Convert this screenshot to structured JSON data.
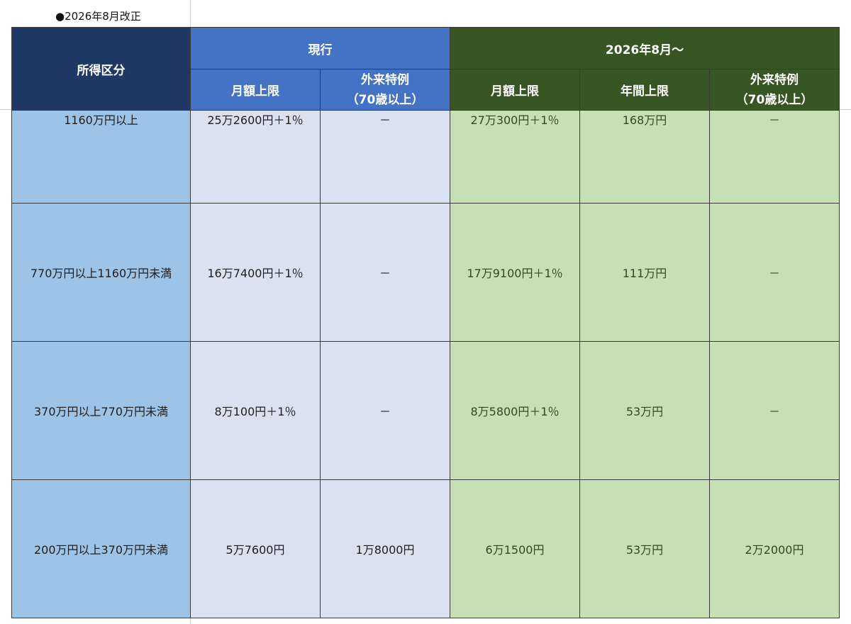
{
  "note": "●2026年8月改正",
  "header": {
    "income": "所得区分",
    "current_group": "現行",
    "new_group": "2026年8月～",
    "current_monthly": "月額上限",
    "current_outpatient_line1": "外来特例",
    "current_outpatient_line2": "（70歳以上）",
    "new_monthly": "月額上限",
    "new_annual": "年間上限",
    "new_outpatient_line1": "外来特例",
    "new_outpatient_line2": "（70歳以上）"
  },
  "rows": [
    {
      "income": "1160万円以上",
      "current_monthly": "25万2600円＋1％",
      "current_outpatient": "－",
      "new_monthly": "27万300円＋1％",
      "new_annual": "168万円",
      "new_outpatient": "－"
    },
    {
      "income": "770万円以上1160万円未満",
      "current_monthly": "16万7400円＋1％",
      "current_outpatient": "－",
      "new_monthly": "17万9100円＋1％",
      "new_annual": "111万円",
      "new_outpatient": "－"
    },
    {
      "income": "370万円以上770万円未満",
      "current_monthly": "8万100円＋1％",
      "current_outpatient": "－",
      "new_monthly": "8万5800円＋1％",
      "new_annual": "53万円",
      "new_outpatient": "－"
    },
    {
      "income": "200万円以上370万円未満",
      "current_monthly": "5万7600円",
      "current_outpatient": "1万8000円",
      "new_monthly": "6万1500円",
      "new_annual": "53万円",
      "new_outpatient": "2万2000円"
    }
  ],
  "colors": {
    "income_header": "#1f3864",
    "current_header": "#4472c4",
    "new_header": "#375623",
    "income_cell": "#9dc3e6",
    "current_cell": "#dae1f1",
    "new_cell": "#c6e0b4"
  }
}
